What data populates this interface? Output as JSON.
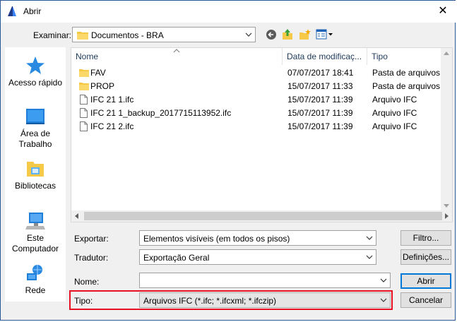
{
  "window": {
    "title": "Abrir",
    "close_glyph": "✕"
  },
  "toolbar": {
    "look_in_label": "Examinar:",
    "look_in_value": "Documentos - BRA",
    "icons": [
      "back-icon",
      "up-folder-icon",
      "new-folder-icon",
      "view-menu-icon"
    ]
  },
  "sidebar": {
    "items": [
      {
        "label": "Acesso rápido",
        "icon": "star-icon"
      },
      {
        "label": "Área de Trabalho",
        "icon": "desktop-icon"
      },
      {
        "label": "Bibliotecas",
        "icon": "libraries-icon"
      },
      {
        "label": "Este Computador",
        "icon": "computer-icon"
      },
      {
        "label": "Rede",
        "icon": "network-icon"
      }
    ]
  },
  "columns": {
    "name": "Nome",
    "date": "Data de modificaç...",
    "type": "Tipo"
  },
  "files": [
    {
      "name": "FAV",
      "date": "07/07/2017 18:41",
      "type": "Pasta de arquivos",
      "kind": "folder"
    },
    {
      "name": "PROP",
      "date": "15/07/2017 11:33",
      "type": "Pasta de arquivos",
      "kind": "folder"
    },
    {
      "name": "IFC 21 1.ifc",
      "date": "15/07/2017 11:39",
      "type": "Arquivo IFC",
      "kind": "file"
    },
    {
      "name": "IFC 21 1_backup_2017715113952.ifc",
      "date": "15/07/2017 11:39",
      "type": "Arquivo IFC",
      "kind": "file"
    },
    {
      "name": "IFC 21 2.ifc",
      "date": "15/07/2017 11:39",
      "type": "Arquivo IFC",
      "kind": "file"
    }
  ],
  "form": {
    "export_label": "Exportar:",
    "export_value": "Elementos visíveis (em todos os pisos)",
    "translator_label": "Tradutor:",
    "translator_value": "Exportação Geral",
    "name_label": "Nome:",
    "name_value": "",
    "type_label": "Tipo:",
    "type_value": "Arquivos IFC (*.ifc; *.ifcxml; *.ifczip)"
  },
  "buttons": {
    "filter": "Filtro...",
    "settings": "Definições...",
    "open": "Abrir",
    "cancel": "Cancelar"
  },
  "colors": {
    "highlight": "#e81123",
    "accent": "#0078d7",
    "folder": "#f7c948"
  }
}
